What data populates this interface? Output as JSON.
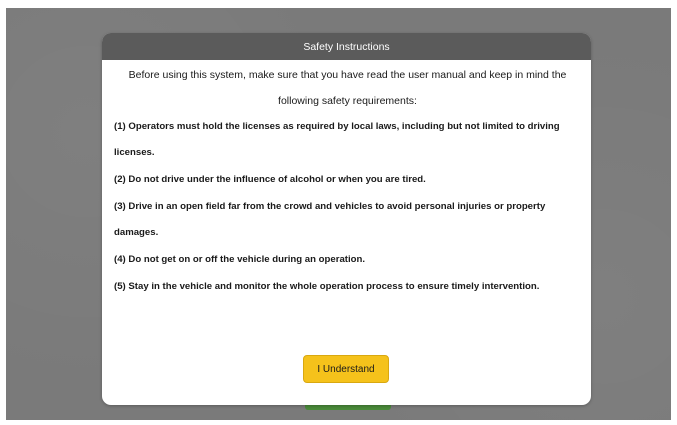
{
  "dialog": {
    "title": "Safety Instructions",
    "intro": "Before using this system, make sure that you have read the user manual and keep in mind the following safety requirements:",
    "rules": [
      "(1) Operators must hold the licenses as required by local laws, including but not limited to driving licenses.",
      "(2) Do not drive under the influence of alcohol or when you are tired.",
      "(3) Drive in an open field far from the crowd and vehicles to avoid personal injuries or property damages.",
      "(4) Do not get on or off the vehicle during an operation.",
      "(5) Stay in the vehicle and monitor the whole operation process to ensure timely intervention."
    ],
    "confirm_label": "I Understand"
  },
  "colors": {
    "overlay": "#7a7a7a",
    "header": "#5b5b5b",
    "confirm_button": "#f5c21b",
    "background_button": "#4a8a3a"
  }
}
